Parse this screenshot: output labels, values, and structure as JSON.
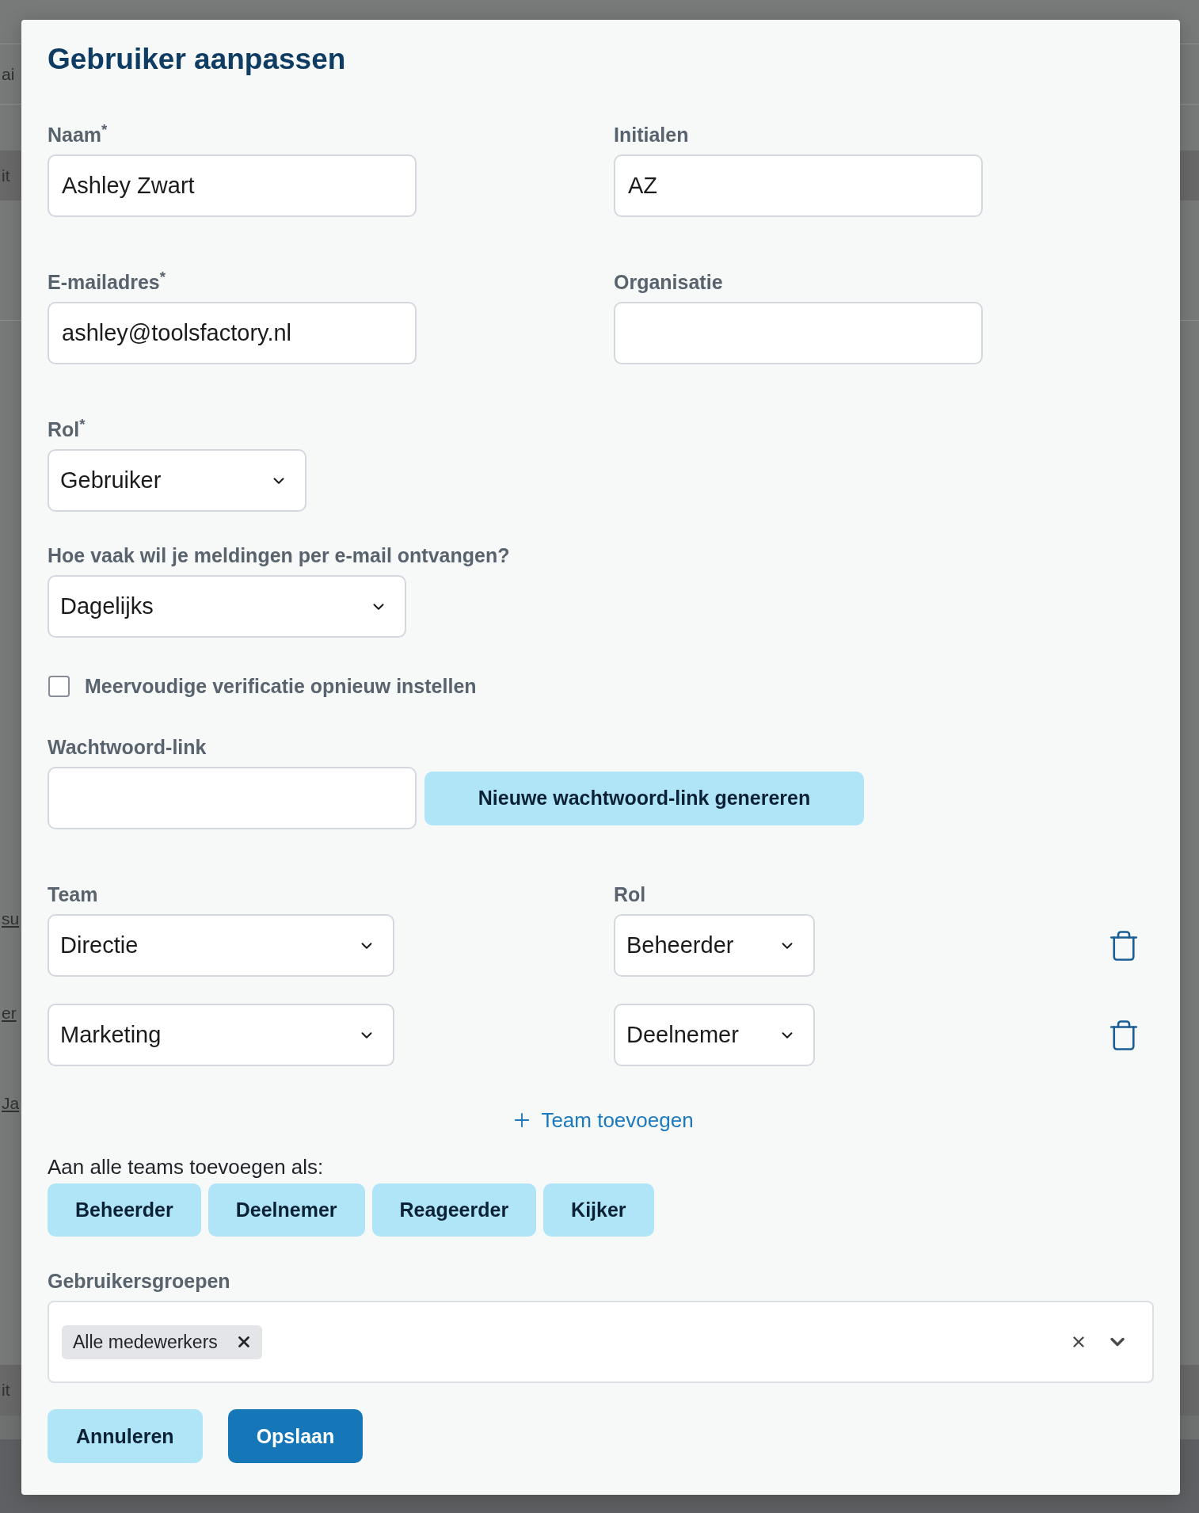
{
  "background": {
    "rows": [
      {
        "kind": "text",
        "text": "ai"
      },
      {
        "kind": "band",
        "text": "it"
      },
      {
        "kind": "link",
        "text": "su"
      },
      {
        "kind": "link",
        "text": "er"
      },
      {
        "kind": "link",
        "text": "Ja"
      },
      {
        "kind": "band",
        "text": "it"
      }
    ]
  },
  "dialog": {
    "title": "Gebruiker aanpassen",
    "fields": [
      {
        "label": "Naam$^{*}$",
        "value": "Ashley Zwart"
      },
      {
        "label": "Initialen",
        "value": "AZ"
      },
      {
        "label": "E-mailadres$^{*}$",
        "value": "ashley@toolsfactory.nl"
      },
      {
        "label": "Organisatie"
      }
    ],
    "role": {
      "label": "Rol$^{*}$",
      "value": "Gebruiker"
    },
    "notifications": {
      "label": "Hoe vaak wil je meldingen per e-mail ontvangen?",
      "value": "Dagelijks"
    },
    "mfa_reset": {
      "label": "Meervoudige verificatie opnieuw instellen",
      "checked": false
    },
    "password_link": {
      "label": "Wachtwoord-link",
      "button": "Nieuwe wachtwoord-link genereren"
    },
    "teams": {
      "team_label": "Team",
      "role_label": "Rol",
      "rows": [
        {
          "team": "Directie",
          "role": "Beheerder"
        },
        {
          "team": "Marketing",
          "role": "Deelnemer"
        }
      ],
      "add": "Team toevoegen"
    },
    "bulk_roles": {
      "label": "Aan alle teams toevoegen als:",
      "buttons": [
        "Beheerder",
        "Deelnemer",
        "Reageerder",
        "Kijker"
      ]
    },
    "user_groups": {
      "label": "Gebruikersgroepen",
      "chips": [
        "Alle medewerkers"
      ]
    },
    "buttons": [
      {
        "kind": "secondary",
        "label": "Annuleren"
      },
      {
        "kind": "primary",
        "label": "Opslaan"
      }
    ]
  }
}
